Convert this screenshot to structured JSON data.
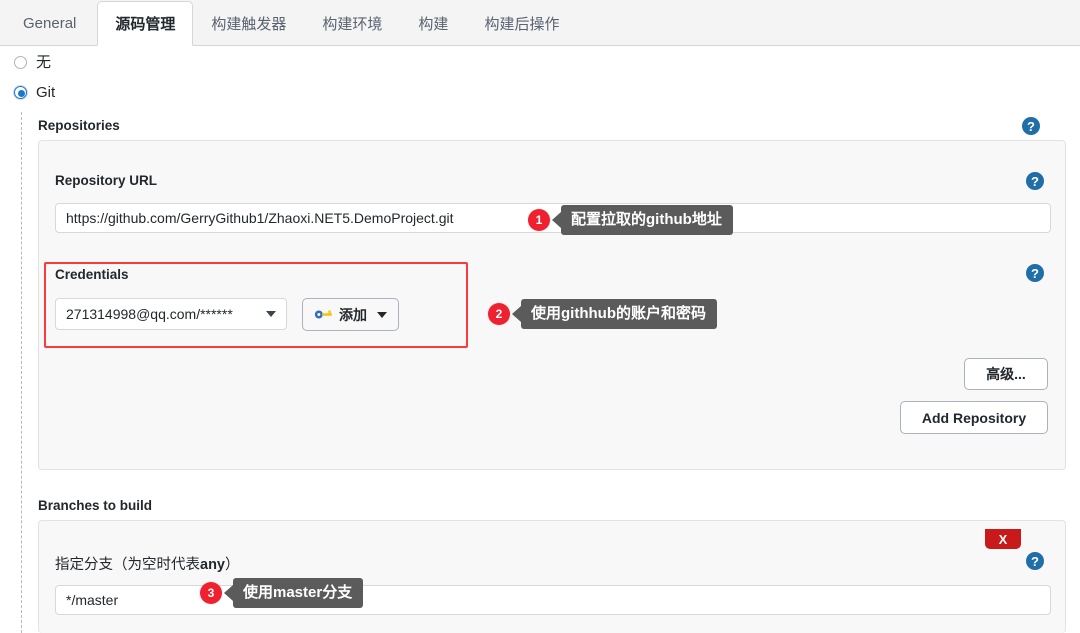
{
  "tabs": [
    {
      "label": "General",
      "active": false
    },
    {
      "label": "源码管理",
      "active": true
    },
    {
      "label": "构建触发器",
      "active": false
    },
    {
      "label": "构建环境",
      "active": false
    },
    {
      "label": "构建",
      "active": false
    },
    {
      "label": "构建后操作",
      "active": false
    }
  ],
  "scm": {
    "options": [
      {
        "label": "无",
        "selected": false
      },
      {
        "label": "Git",
        "selected": true
      }
    ]
  },
  "repositories": {
    "heading": "Repositories",
    "help": "?",
    "repo_url": {
      "label": "Repository URL",
      "value": "https://github.com/GerryGithub1/Zhaoxi.NET5.DemoProject.git",
      "help": "?"
    },
    "credentials": {
      "label": "Credentials",
      "selected": "271314998@qq.com/******",
      "add_button": "添加",
      "help": "?"
    },
    "advanced_button": "高级...",
    "add_repository_button": "Add Repository"
  },
  "branches": {
    "heading": "Branches to build",
    "remove_button": "X",
    "branch_label_prefix": "指定分支（为空时代表",
    "branch_label_bold": "any",
    "branch_label_suffix": "）",
    "value": "*/master",
    "help": "?"
  },
  "annotations": [
    {
      "number": "1",
      "text": "配置拉取的github地址"
    },
    {
      "number": "2",
      "text": "使用githhub的账户和密码"
    },
    {
      "number": "3",
      "text": "使用master分支"
    }
  ],
  "colors": {
    "accent_blue": "#1878cf",
    "help_blue": "#1f6ea8",
    "highlight_red": "#fb3b3b",
    "badge_red": "#f0212f",
    "remove_red": "#c8191b",
    "bubble_gray": "#5b5b5b"
  }
}
